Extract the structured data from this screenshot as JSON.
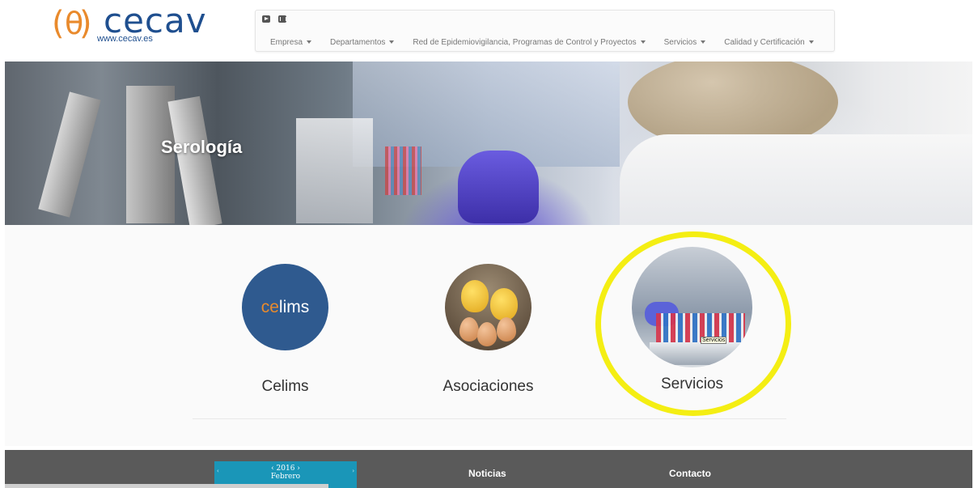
{
  "header": {
    "logo": {
      "word": "cecav",
      "url": "www.cecav.es"
    },
    "social": [
      "youtube-icon",
      "linkedin-icon"
    ],
    "menu": [
      {
        "label": "Empresa"
      },
      {
        "label": "Departamentos"
      },
      {
        "label": "Red de Epidemiovigilancia, Programas de Control y Proyectos"
      },
      {
        "label": "Servicios"
      },
      {
        "label": "Calidad y Certificación"
      }
    ]
  },
  "hero": {
    "title": "Serología"
  },
  "cards": [
    {
      "label": "Celims",
      "logo_pre": "ce",
      "logo_post": "lims"
    },
    {
      "label": "Asociaciones"
    },
    {
      "label": "Servicios",
      "tooltip": "Servicios"
    }
  ],
  "colors": {
    "highlight_ring": "#f4ee13",
    "footer": "#5a5a5a",
    "calendar": "#1a96b8",
    "brand_blue": "#1f4f8f",
    "brand_orange": "#e98a2c"
  },
  "footer": {
    "calendar": {
      "year": "‹ 2016 ›",
      "month": "Febrero",
      "prev": "‹",
      "next": "›"
    },
    "noticias": "Noticias",
    "contacto": "Contacto"
  }
}
